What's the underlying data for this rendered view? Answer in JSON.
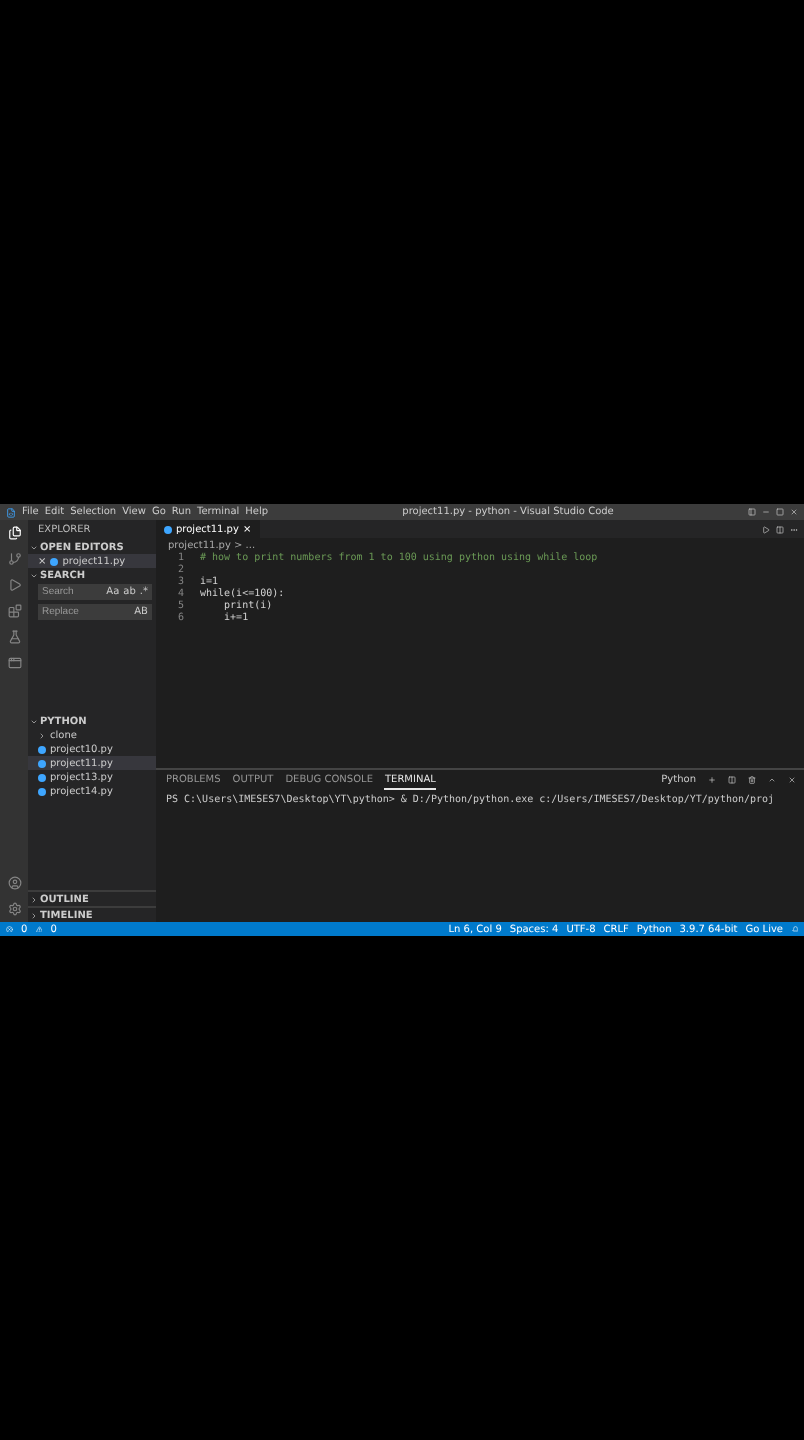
{
  "window": {
    "title": "project11.py - python - Visual Studio Code",
    "menu": [
      "File",
      "Edit",
      "Selection",
      "View",
      "Go",
      "Run",
      "Terminal",
      "Help"
    ]
  },
  "activity_bar": {
    "items": [
      {
        "kind": "files",
        "selected": true
      },
      {
        "kind": "source",
        "selected": false
      },
      {
        "kind": "run",
        "selected": false
      },
      {
        "kind": "extensions",
        "selected": false
      },
      {
        "kind": "flask",
        "selected": false
      },
      {
        "kind": "window",
        "selected": false
      }
    ]
  },
  "sidebar": {
    "title": "EXPLORER",
    "open_editors": {
      "title": "OPEN EDITORS",
      "items": [
        {
          "close": "×",
          "name": "project11.py"
        }
      ]
    },
    "search": {
      "title": "SEARCH",
      "search_placeholder": "Search",
      "search_options": [
        "Aa",
        "ab",
        ".*"
      ],
      "replace_placeholder": "Replace",
      "replace_option": "AB"
    },
    "folder": {
      "title": "PYTHON",
      "items": [
        {
          "kind": "folder",
          "name": "clone",
          "selected": false
        },
        {
          "kind": "file",
          "name": "project10.py",
          "selected": false
        },
        {
          "kind": "file",
          "name": "project11.py",
          "selected": true
        },
        {
          "kind": "file",
          "name": "project13.py",
          "selected": false
        },
        {
          "kind": "file",
          "name": "project14.py",
          "selected": false
        }
      ]
    },
    "outline": "OUTLINE",
    "timeline": "TIMELINE"
  },
  "editor": {
    "tab": {
      "name": "project11.py",
      "close": "×"
    },
    "breadcrumb": "project11.py > ...",
    "lines": [
      {
        "number": "1",
        "kind": "comment",
        "text": "# how to print numbers from 1 to 100 using python using while loop"
      },
      {
        "number": "2",
        "kind": "blank"
      },
      {
        "number": "3",
        "kind": "code",
        "text": "i=1"
      },
      {
        "number": "4",
        "kind": "code",
        "text": "while(i<=100):"
      },
      {
        "number": "5",
        "kind": "code",
        "text": "    print(i)"
      },
      {
        "number": "6",
        "kind": "code",
        "text": "    i+=1"
      }
    ]
  },
  "panel": {
    "tabs": [
      {
        "label": "PROBLEMS",
        "selected": false
      },
      {
        "label": "OUTPUT",
        "selected": false
      },
      {
        "label": "DEBUG CONSOLE",
        "selected": false
      },
      {
        "label": "TERMINAL",
        "selected": true
      }
    ],
    "terminal_name": "Python",
    "terminal_line": "PS C:\\Users\\IMESES7\\Desktop\\YT\\python> & D:/Python/python.exe c:/Users/IMESES7/Desktop/YT/python/proj"
  },
  "status_bar": {
    "errors": "0",
    "warnings": "0",
    "items": [
      "Ln 6, Col 9",
      "Spaces: 4",
      "UTF-8",
      "CRLF",
      "Python",
      "3.9.7 64-bit",
      "Go Live"
    ]
  }
}
